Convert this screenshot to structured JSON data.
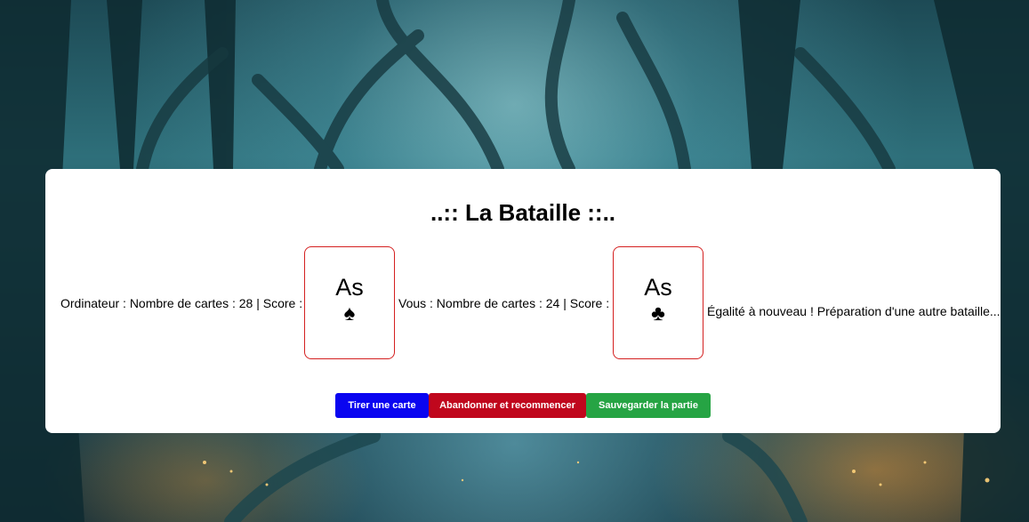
{
  "game": {
    "title": "..:: La Bataille ::.."
  },
  "computer": {
    "status": "Ordinateur : Nombre de cartes : 28 | Score : 4",
    "card": {
      "rank": "As",
      "suit": "♠"
    }
  },
  "player": {
    "status": "Vous : Nombre de cartes : 24 | Score : 2",
    "card": {
      "rank": "As",
      "suit": "♣"
    }
  },
  "message": "Égalité à nouveau ! Préparation d'une autre bataille...",
  "buttons": {
    "draw": "Tirer une carte",
    "quit": "Abandonner et recommencer",
    "save": "Sauvegarder la partie"
  },
  "colors": {
    "draw_button": "#0a05f0",
    "quit_button": "#c0071d",
    "save_button": "#26a444",
    "card_border": "#d42020"
  },
  "icons": {
    "computer_card_suit": "spade-icon",
    "player_card_suit": "club-icon"
  }
}
